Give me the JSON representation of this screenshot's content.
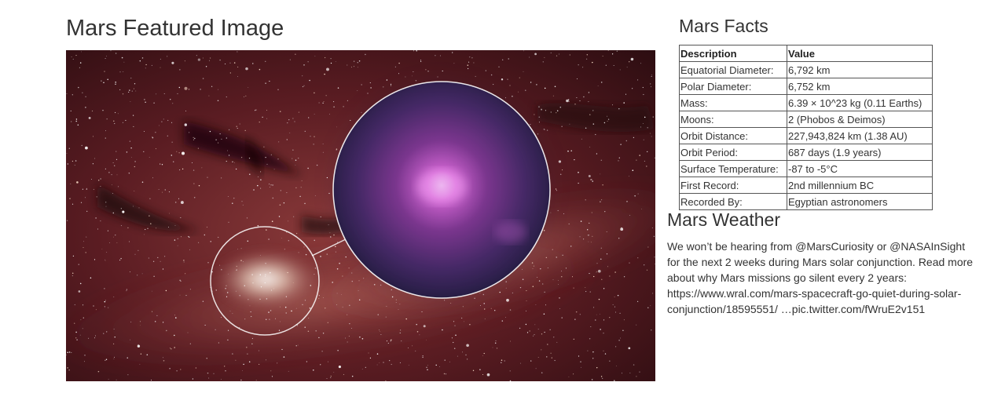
{
  "featured": {
    "title": "Mars Featured Image"
  },
  "facts": {
    "title": "Mars Facts",
    "header": [
      "Description",
      "Value"
    ],
    "rows": [
      [
        "Equatorial Diameter:",
        "6,792 km"
      ],
      [
        "Polar Diameter:",
        "6,752 km"
      ],
      [
        "Mass:",
        "6.39 × 10^23 kg (0.11 Earths)"
      ],
      [
        "Moons:",
        "2 (Phobos & Deimos)"
      ],
      [
        "Orbit Distance:",
        "227,943,824 km (1.38 AU)"
      ],
      [
        "Orbit Period:",
        "687 days (1.9 years)"
      ],
      [
        "Surface Temperature:",
        "-87 to -5°C"
      ],
      [
        "First Record:",
        "2nd millennium BC"
      ],
      [
        "Recorded By:",
        "Egyptian astronomers"
      ]
    ]
  },
  "weather": {
    "title": "Mars Weather",
    "text_line1": "We won’t be hearing from @MarsCuriosity or @NASAInSight",
    "text_line2": "for the next 2 weeks during Mars solar conjunction. Read more",
    "text_line3": "about why Mars missions go silent every 2 years:",
    "text_line4": "https://www.wral.com/mars-spacecraft-go-quiet-during-solar-",
    "text_line5": "conjunction/18595551/ …pic.twitter.com/fWruE2v151"
  },
  "colors": {
    "text": "#333333",
    "table_border": "#555555",
    "nebula_red": "#7a2a2e",
    "nebula_dark": "#2a0d10",
    "magenta_glow": "#e060e0"
  }
}
